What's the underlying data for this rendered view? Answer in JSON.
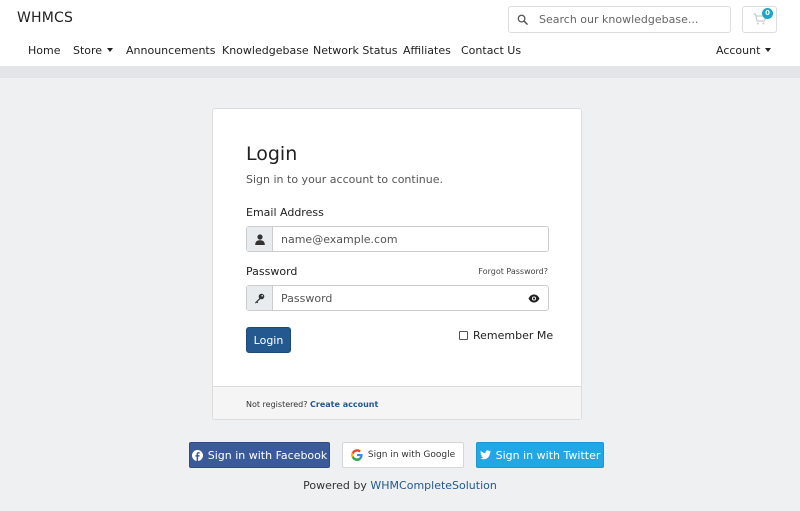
{
  "header": {
    "brand": "WHMCS",
    "search": {
      "placeholder": "Search our knowledgebase...",
      "value": ""
    },
    "cart": {
      "count": "0"
    },
    "nav": {
      "items": [
        {
          "label": "Home"
        },
        {
          "label": "Store"
        },
        {
          "label": "Announcements"
        },
        {
          "label": "Knowledgebase"
        },
        {
          "label": "Network Status"
        },
        {
          "label": "Affiliates"
        },
        {
          "label": "Contact Us"
        }
      ],
      "account_label": "Account"
    }
  },
  "login_card": {
    "title": "Login",
    "subtitle": "Sign in to your account to continue.",
    "email": {
      "label": "Email Address",
      "placeholder": "name@example.com",
      "value": ""
    },
    "password": {
      "label": "Password",
      "placeholder": "Password",
      "value": ""
    },
    "forgot_label": "Forgot Password?",
    "login_button": "Login",
    "remember_label": "Remember Me",
    "remember_checked": false,
    "footer": {
      "prefix": "Not registered?",
      "link": "Create account"
    }
  },
  "social": {
    "facebook": "Sign in with Facebook",
    "google": "Sign in with Google",
    "twitter": "Sign in with Twitter"
  },
  "powered": {
    "prefix": "Powered by",
    "link": "WHMCompleteSolution"
  },
  "icons": {
    "search": "search-icon",
    "cart": "cart-icon",
    "user": "user-icon",
    "key": "key-icon",
    "eye": "eye-icon",
    "facebook": "facebook-icon",
    "google": "google-icon",
    "twitter": "twitter-icon"
  },
  "colors": {
    "primary": "#24598f",
    "badge": "#16a9c2",
    "facebook": "#3b5a9a",
    "twitter": "#20a7e4",
    "background": "#eef0f2"
  }
}
